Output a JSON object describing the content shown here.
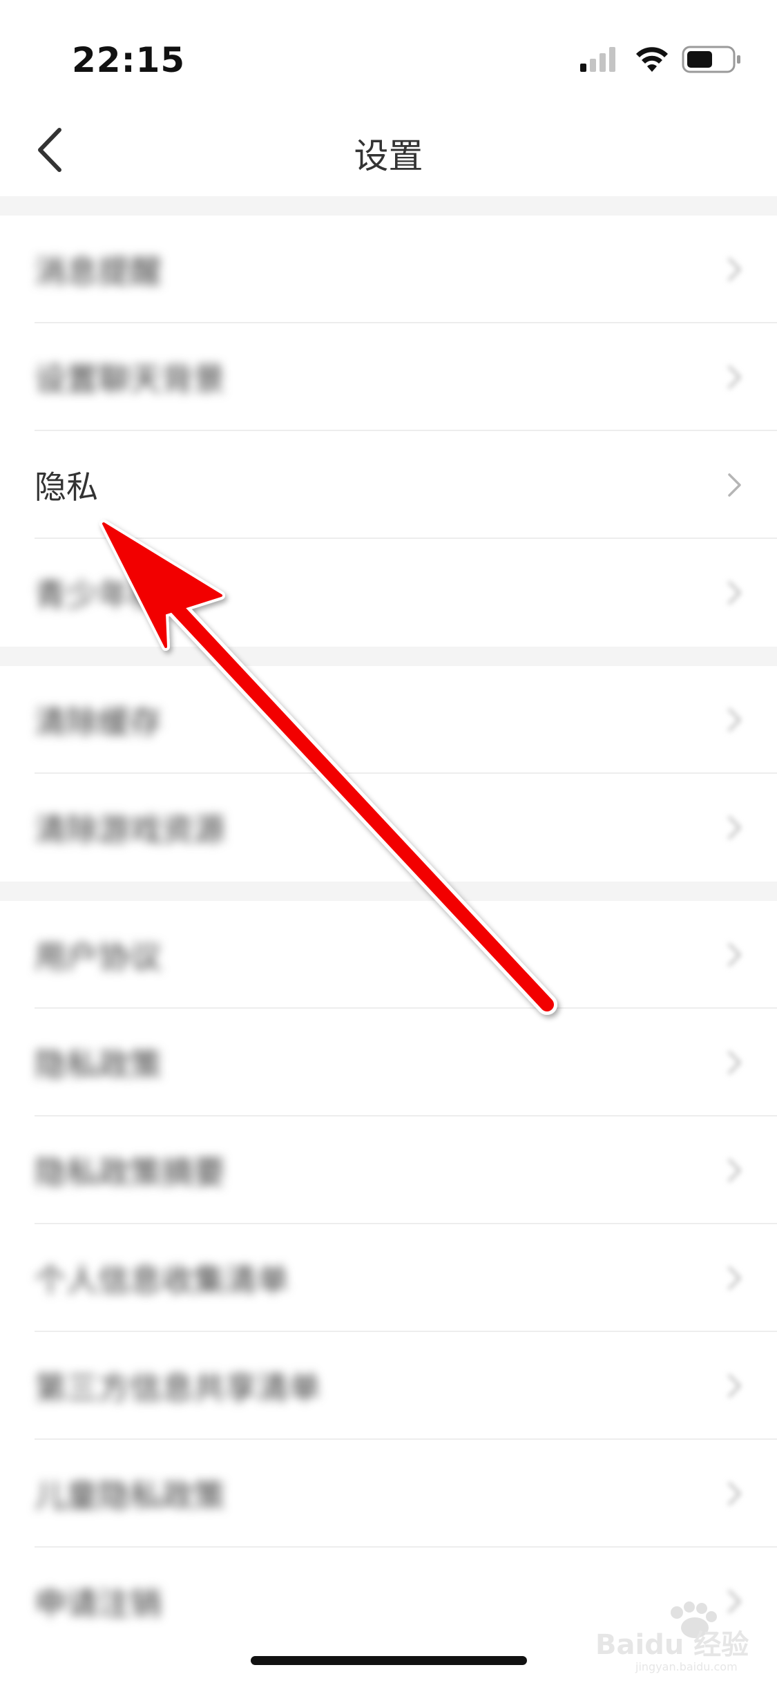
{
  "status_bar": {
    "time": "22:15",
    "icons": [
      "signal-icon",
      "wifi-icon",
      "battery-icon"
    ]
  },
  "nav": {
    "title": "设置",
    "back_icon": "chevron-left-icon"
  },
  "sections": [
    {
      "items": [
        {
          "label": "消息提醒",
          "blurred": true
        },
        {
          "label": "设置聊天背景",
          "blurred": true
        },
        {
          "label": "隐私",
          "blurred": false,
          "highlighted": true
        },
        {
          "label": "青少年模式",
          "blurred": true
        }
      ]
    },
    {
      "items": [
        {
          "label": "清除缓存",
          "blurred": true
        },
        {
          "label": "清除游戏资源",
          "blurred": true
        }
      ]
    },
    {
      "items": [
        {
          "label": "用户协议",
          "blurred": true
        },
        {
          "label": "隐私政策",
          "blurred": true
        },
        {
          "label": "隐私政策摘要",
          "blurred": true
        },
        {
          "label": "个人信息收集清单",
          "blurred": true
        },
        {
          "label": "第三方信息共享清单",
          "blurred": true
        },
        {
          "label": "儿童隐私政策",
          "blurred": true
        },
        {
          "label": "申请注销",
          "blurred": true
        }
      ]
    }
  ],
  "annotation": {
    "type": "arrow",
    "color": "#ff0000",
    "points_to": "隐私"
  },
  "watermark": {
    "text": "Baidu 经验",
    "subtext": "jingyan.baidu.com"
  },
  "colors": {
    "background": "#ffffff",
    "section_gap": "#f4f4f4",
    "text": "#333333",
    "chevron": "#b5b5b5",
    "divider": "#ededed"
  }
}
